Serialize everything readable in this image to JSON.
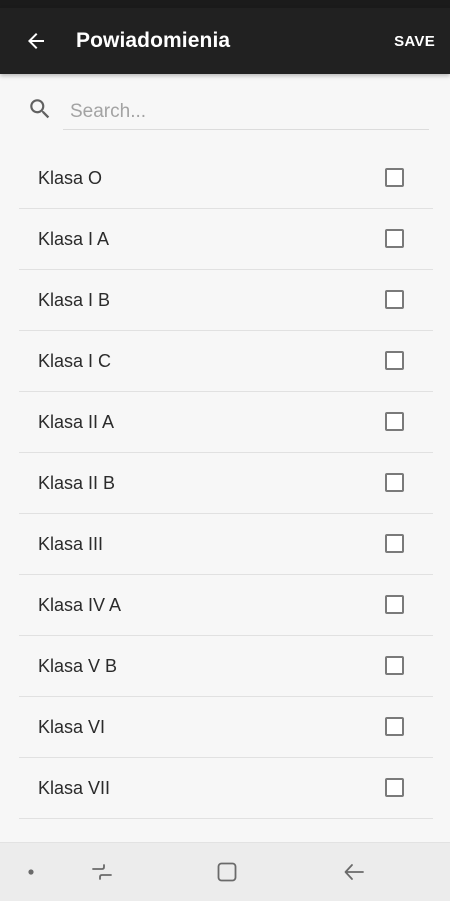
{
  "toolbar": {
    "title": "Powiadomienia",
    "save_label": "SAVE"
  },
  "search": {
    "placeholder": "Search..."
  },
  "classes": [
    {
      "label": "Klasa O",
      "checked": false
    },
    {
      "label": "Klasa I A",
      "checked": false
    },
    {
      "label": "Klasa I B",
      "checked": false
    },
    {
      "label": "Klasa I C",
      "checked": false
    },
    {
      "label": "Klasa II A",
      "checked": false
    },
    {
      "label": "Klasa II B",
      "checked": false
    },
    {
      "label": "Klasa III",
      "checked": false
    },
    {
      "label": "Klasa IV A",
      "checked": false
    },
    {
      "label": "Klasa V B",
      "checked": false
    },
    {
      "label": "Klasa VI",
      "checked": false
    },
    {
      "label": "Klasa VII",
      "checked": false
    }
  ],
  "icons": {
    "back": "arrow-left-icon",
    "search": "search-icon",
    "nav_dot": "dot-icon",
    "nav_recents": "recents-icon",
    "nav_home": "home-icon",
    "nav_back": "back-icon"
  },
  "colors": {
    "toolbar_bg": "#212121",
    "background": "#f7f7f7",
    "nav_bar_bg": "#ececec"
  }
}
